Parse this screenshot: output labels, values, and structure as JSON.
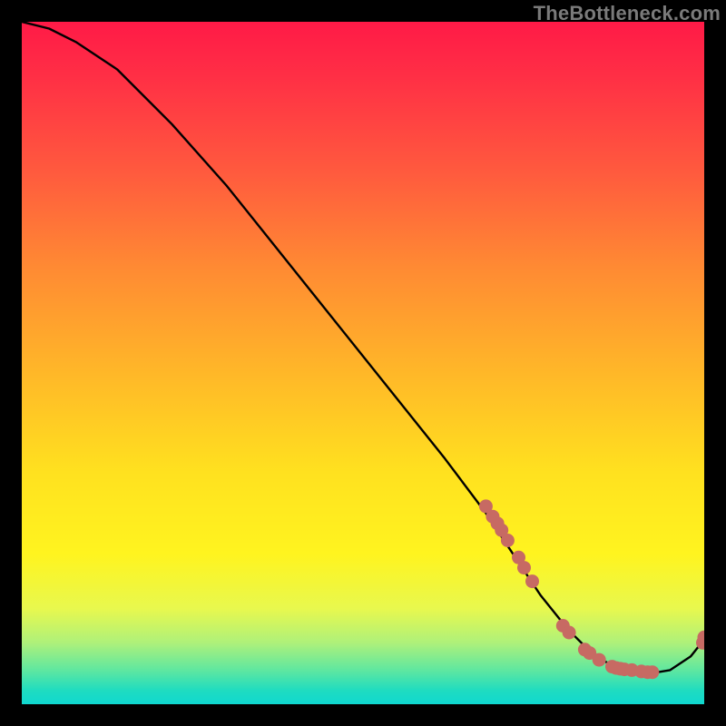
{
  "watermark": "TheBottleneck.com",
  "chart_data": {
    "type": "line",
    "title": "",
    "xlabel": "",
    "ylabel": "",
    "xlim": [
      0,
      100
    ],
    "ylim": [
      0,
      100
    ],
    "grid": false,
    "legend": false,
    "curve": {
      "name": "bottleneck-curve",
      "x": [
        0,
        4,
        8,
        14,
        22,
        30,
        38,
        46,
        54,
        62,
        68,
        72,
        76,
        80,
        84,
        88,
        92,
        95,
        98,
        100
      ],
      "y": [
        100,
        99,
        97,
        93,
        85,
        76,
        66,
        56,
        46,
        36,
        28,
        22,
        16,
        11,
        7,
        5,
        4.5,
        5,
        7,
        9.5
      ]
    },
    "points": {
      "name": "sample-points",
      "color": "#c76a63",
      "x": [
        68,
        69,
        69.7,
        70.3,
        71.2,
        72.8,
        73.6,
        74.8,
        79.3,
        80.2,
        82.5,
        83.2,
        84.6,
        86.5,
        87.1,
        87.7,
        88.3,
        89.4,
        90.8,
        91.7,
        92.4,
        99.8,
        100
      ],
      "y": [
        29.0,
        27.5,
        26.5,
        25.5,
        24.0,
        21.5,
        20.0,
        18.0,
        11.5,
        10.5,
        8.0,
        7.5,
        6.5,
        5.5,
        5.3,
        5.2,
        5.1,
        5.0,
        4.8,
        4.7,
        4.7,
        9.0,
        9.8
      ]
    }
  }
}
